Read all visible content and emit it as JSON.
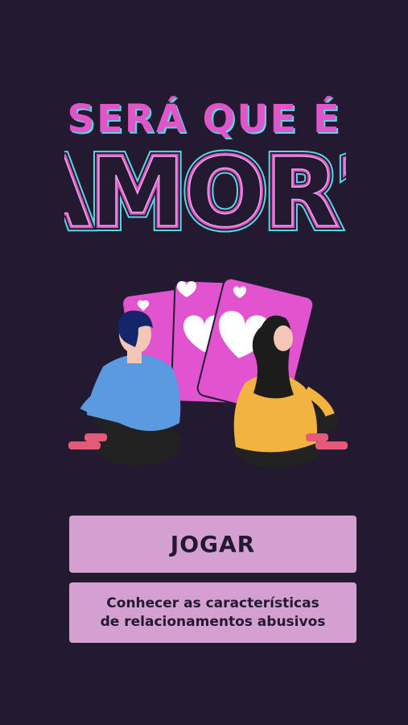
{
  "title": {
    "line1": "SERÁ QUE É",
    "line2": "AMOR?"
  },
  "buttons": {
    "play_label": "JOGAR",
    "info_line1": "Conhecer as características",
    "info_line2": "de relacionamentos abusivos"
  },
  "colors": {
    "background": "#231a31",
    "title_pink": "#e056c9",
    "title_cyan": "#5ad6e0",
    "button": "#d49fd1",
    "card": "#e254cf"
  }
}
